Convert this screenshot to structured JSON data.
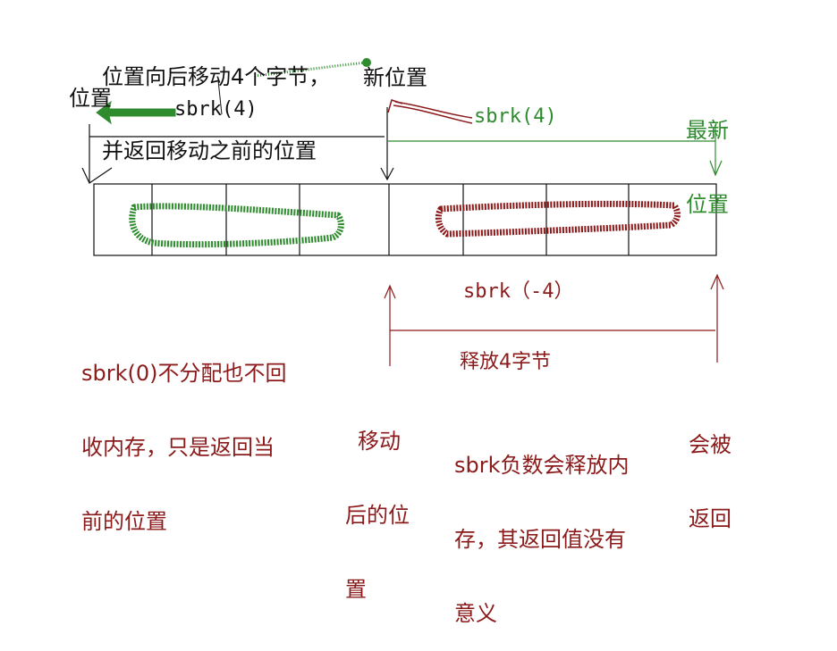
{
  "colors": {
    "black": "#111111",
    "green": "#2e8b2e",
    "dark_red": "#8b1a1a"
  },
  "top_note": {
    "line1": "位置向后移动4个字节，",
    "line2": "并返回移动之前的位置"
  },
  "pos_label": "位置",
  "new_pos_label": "新位置",
  "latest_pos_label": {
    "line1": "最新",
    "line2": "位置"
  },
  "sbrk_4_left": "sbrk(4)",
  "sbrk_4_right": "sbrk(4)",
  "sbrk_neg4": "sbrk（-4）",
  "release_label": "释放4字节",
  "sbrk0_note": {
    "line1": "sbrk(0)不分配也不回",
    "line2": "收内存，只是返回当",
    "line3": "前的位置"
  },
  "moved_label": {
    "line1": "移动",
    "line2": "后的位",
    "line3": "置"
  },
  "negative_note": {
    "line1": "sbrk负数会释放内",
    "line2": "存，其返回值没有",
    "line3": "意义"
  },
  "returned_label": {
    "line1": "会被",
    "line2": "返回"
  },
  "memory_cells": 8
}
